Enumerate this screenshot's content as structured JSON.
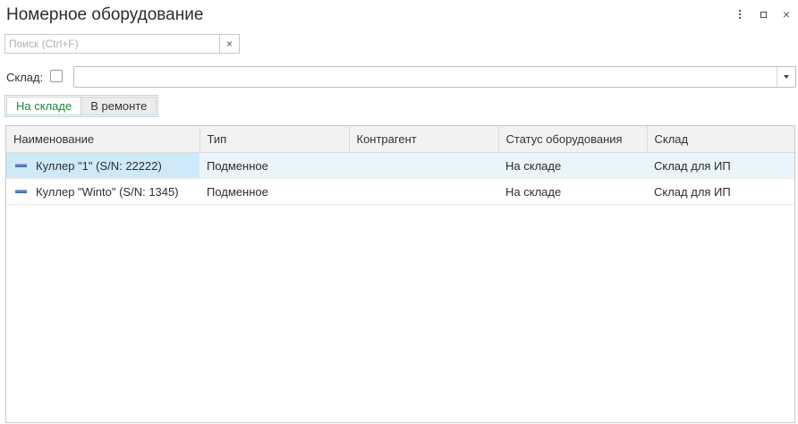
{
  "window": {
    "title": "Номерное оборудование",
    "close_glyph": "×"
  },
  "search": {
    "placeholder": "Поиск (Ctrl+F)",
    "value": "",
    "clear_glyph": "×"
  },
  "filter": {
    "label": "Склад:",
    "checked": false,
    "value": ""
  },
  "tabs": [
    {
      "label": "На складе",
      "active": true
    },
    {
      "label": "В ремонте",
      "active": false
    }
  ],
  "table": {
    "columns": [
      "Наименование",
      "Тип",
      "Контрагент",
      "Статус оборудования",
      "Склад"
    ],
    "rows": [
      {
        "name": "Куллер \"1\" (S/N: 22222)",
        "type": "Подменное",
        "counterparty": "",
        "status": "На складе",
        "warehouse": "Склад для ИП",
        "selected": true
      },
      {
        "name": "Куллер \"Winto\" (S/N: 1345)",
        "type": "Подменное",
        "counterparty": "",
        "status": "На складе",
        "warehouse": "Склад для ИП",
        "selected": false
      }
    ]
  },
  "colors": {
    "active_tab_text": "#1e8a3d",
    "selected_row": "#e9f4fb",
    "selected_cell": "#cfe9f8",
    "row_icon": "#5a87b4"
  },
  "icons": {
    "menu": "kebab-menu-icon",
    "maximize": "maximize-icon",
    "close": "close-icon",
    "row": "equipment-item-icon"
  }
}
